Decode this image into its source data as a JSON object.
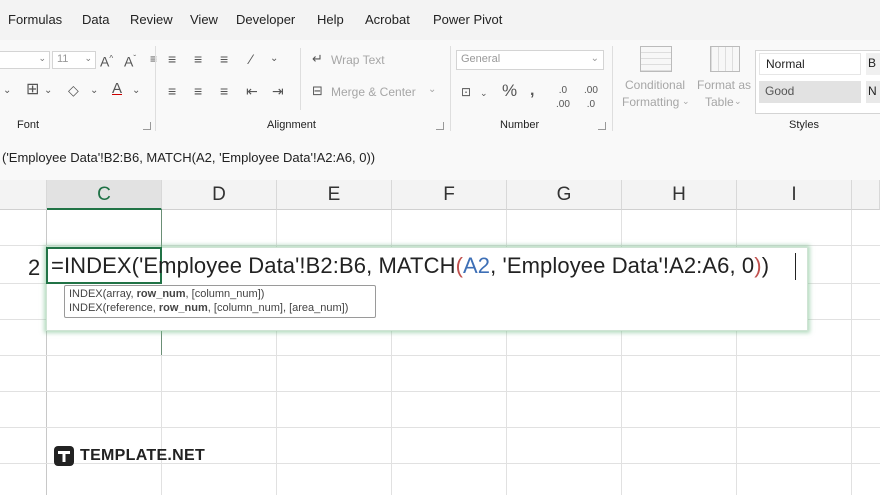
{
  "menu": {
    "tabs": [
      "Formulas",
      "Data",
      "Review",
      "View",
      "Developer",
      "Help",
      "Acrobat",
      "Power Pivot"
    ]
  },
  "ribbon": {
    "font": {
      "size_value": "11",
      "label": "Font"
    },
    "alignment": {
      "wrap_text": "Wrap Text",
      "merge_center": "Merge & Center",
      "label": "Alignment"
    },
    "number": {
      "format_value": "General",
      "label": "Number"
    },
    "styles": {
      "conditional_formatting_line1": "Conditional",
      "conditional_formatting_line2": "Formatting",
      "format_as_table_line1": "Format as",
      "format_as_table_line2": "Table",
      "normal": "Normal",
      "good": "Good",
      "label": "Styles"
    }
  },
  "formula_bar": {
    "text": "('Employee Data'!B2:B6, MATCH(A2, 'Employee Data'!A2:A6, 0))"
  },
  "grid": {
    "columns": [
      "C",
      "D",
      "E",
      "F",
      "G",
      "H",
      "I"
    ],
    "selected_column": "C",
    "row_number": "2"
  },
  "edit": {
    "part1": "=INDEX('Employee Data'!B2:B6, MATCH",
    "open_paren": "(",
    "ref": "A2",
    "part2": ", 'Employee Data'!A2:A6, 0",
    "close_paren": ")",
    "final_paren": ")"
  },
  "tooltip": {
    "line1_pre": "INDEX(array, ",
    "line1_bold": "row_num",
    "line1_post": ", [column_num])",
    "line2_pre": "INDEX(reference, ",
    "line2_bold": "row_num",
    "line2_post": ", [column_num], [area_num])"
  },
  "logo": {
    "text": "TEMPLATE.NET"
  },
  "colors": {
    "accent_green": "#217346",
    "ref_blue": "#3d6fb6",
    "paren_red": "#c0504d"
  }
}
